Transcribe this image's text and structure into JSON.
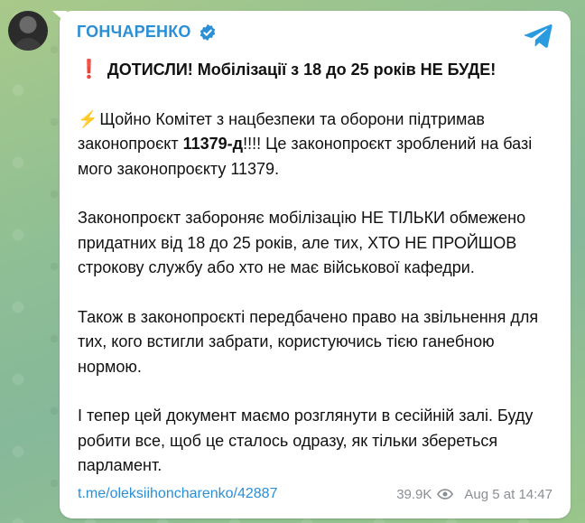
{
  "post": {
    "channel_name": "ГОНЧАРЕНКО",
    "headline_icon": "❗",
    "headline": "ДОТИСЛИ! Мобілізації з 18 до 25 років НЕ БУДЕ!",
    "p1": {
      "icon": "⚡",
      "before": "Щойно Комітет з нацбезпеки та оборони підтримав законопроєкт ",
      "bill": "11379-д",
      "after": "!!!! Це законопроєкт зроблений на базі мого законопроєкту 11379."
    },
    "p2": "Законопроєкт забороняє мобілізацію НЕ ТІЛЬКИ обмежено придатних від 18 до 25 років, але тих, ХТО НЕ ПРОЙШОВ строкову службу або хто не має військової кафедри.",
    "p3": "Також в законопроєкті передбачено право на звільнення для тих, кого встигли забрати, користуючись тією ганебною нормою.",
    "p4": "І тепер цей документ маємо розглянути в сесійній залі. Буду робити все, щоб це сталось одразу, як тільки збереться парламент.",
    "link": "t.me/oleksiihoncharenko/42887",
    "views": "39.9K",
    "date": "Aug 5 at 14:47"
  },
  "colors": {
    "accent": "#2a8fd4",
    "meta_text": "#8a8f94",
    "warning": "#e02020",
    "bolt": "#f3b41a"
  },
  "icons": {
    "verified": "verified-badge-icon",
    "share": "telegram-share-icon",
    "views": "eye-icon"
  }
}
